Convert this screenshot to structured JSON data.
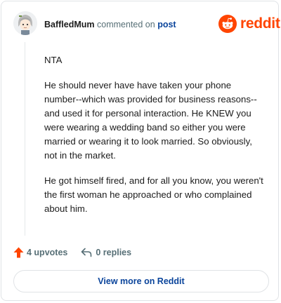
{
  "header": {
    "author": "BaffledMum",
    "action": "commented on",
    "target": "post",
    "brand": "reddit"
  },
  "comment": {
    "paragraphs": [
      "NTA",
      "He should never have have taken your phone number--which was provided for business reasons--and used it for personal interaction. He KNEW you were wearing a wedding band so either you were married or wearing it to look married. So obviously, not in the market.",
      "He got himself fired, and for all you know, you weren't the first woman he approached or who complained about him."
    ]
  },
  "actions": {
    "upvotes": "4 upvotes",
    "replies": "0 replies"
  },
  "footer": {
    "view_more": "View more on Reddit"
  },
  "colors": {
    "brand": "#ff4500",
    "link": "#0a449b",
    "muted": "#576f76"
  },
  "icons": [
    "avatar",
    "reddit-snoo-icon",
    "upvote-arrow-icon",
    "reply-arrow-icon"
  ]
}
